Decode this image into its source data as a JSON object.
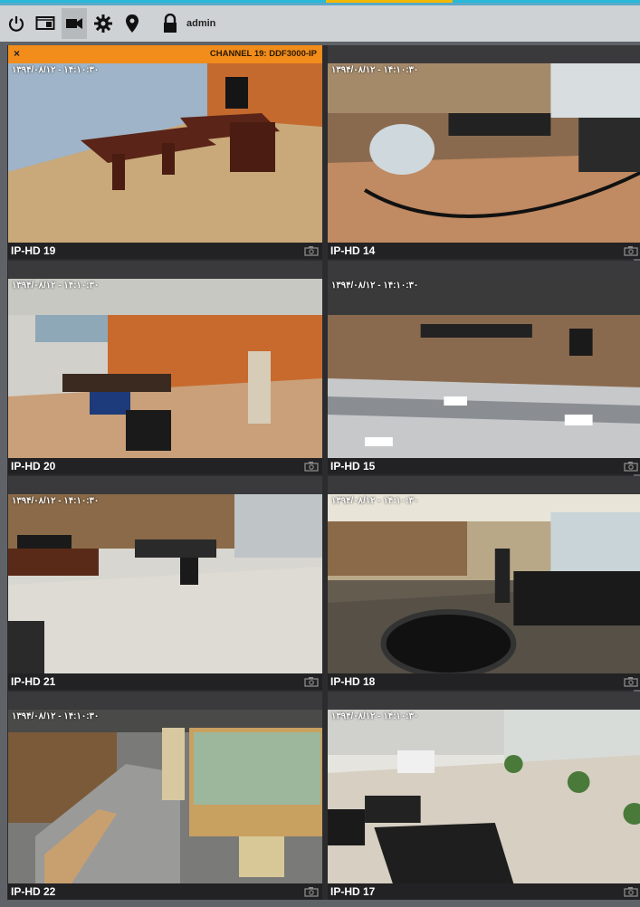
{
  "toolbar": {
    "icons": [
      "power-icon",
      "monitor-layout-icon",
      "camera-video-icon",
      "gear-icon",
      "location-pin-icon",
      "lock-icon"
    ],
    "user": "admin"
  },
  "selected_channel": {
    "close_symbol": "×",
    "label": "CHANNEL 19: DDF3000-IP"
  },
  "tiles": [
    {
      "timestamp": "۱۳۹۴/۰۸/۱۲ - ۱۴:۱۰:۳۰",
      "name": "IP-HD 19"
    },
    {
      "timestamp": "۱۳۹۴/۰۸/۱۲ - ۱۴:۱۰:۳۰",
      "name": "IP-HD 14"
    },
    {
      "timestamp": "۱۳۹۴/۰۸/۱۲ - ۱۴:۱۰:۳۰",
      "name": "IP-HD 20"
    },
    {
      "timestamp": "۱۳۹۴/۰۸/۱۲ - ۱۴:۱۰:۳۰",
      "name": "IP-HD 15"
    },
    {
      "timestamp": "۱۳۹۴/۰۸/۱۲ - ۱۴:۱۰:۳۰",
      "name": "IP-HD 21"
    },
    {
      "timestamp": "۱۳۹۴/۰۸/۱۲ - ۱۴:۱۰:۳۰",
      "name": "IP-HD 18"
    },
    {
      "timestamp": "۱۳۹۴/۰۸/۱۲ - ۱۴:۱۰:۳۰",
      "name": "IP-HD 22"
    },
    {
      "timestamp": "۱۳۹۴/۰۸/۱۲ - ۱۴:۱۰:۳۰",
      "name": "IP-HD 17"
    }
  ],
  "colors": {
    "accent_orange": "#f28c1b",
    "accent_cyan": "#28b8d8",
    "accent_yellow": "#f2b800"
  }
}
